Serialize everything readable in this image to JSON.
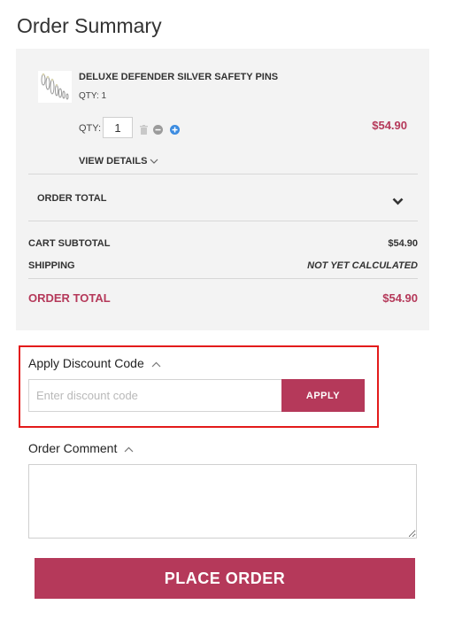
{
  "page": {
    "title": "Order Summary",
    "accent_color": "#b5395a",
    "highlight_color": "#e31b1b"
  },
  "cart_item": {
    "name": "DELUXE DEFENDER SILVER SAFETY PINS",
    "qty_summary": "QTY: 1",
    "qty_label": "QTY:",
    "qty_value": "1",
    "line_price": "$54.90",
    "view_details_label": "VIEW DETAILS",
    "thumbnail_icon": "safety-pins-product-image"
  },
  "order_total_toggle": {
    "label": "ORDER TOTAL",
    "icon": "chevron-down-icon"
  },
  "totals": {
    "subtotal_label": "CART SUBTOTAL",
    "subtotal_value": "$54.90",
    "shipping_label": "SHIPPING",
    "shipping_value": "NOT YET CALCULATED",
    "grand_label": "ORDER TOTAL",
    "grand_value": "$54.90"
  },
  "discount": {
    "title": "Apply Discount Code",
    "placeholder": "Enter discount code",
    "value": "",
    "apply_label": "APPLY"
  },
  "comment": {
    "title": "Order Comment",
    "value": ""
  },
  "actions": {
    "place_order_label": "PLACE ORDER"
  }
}
